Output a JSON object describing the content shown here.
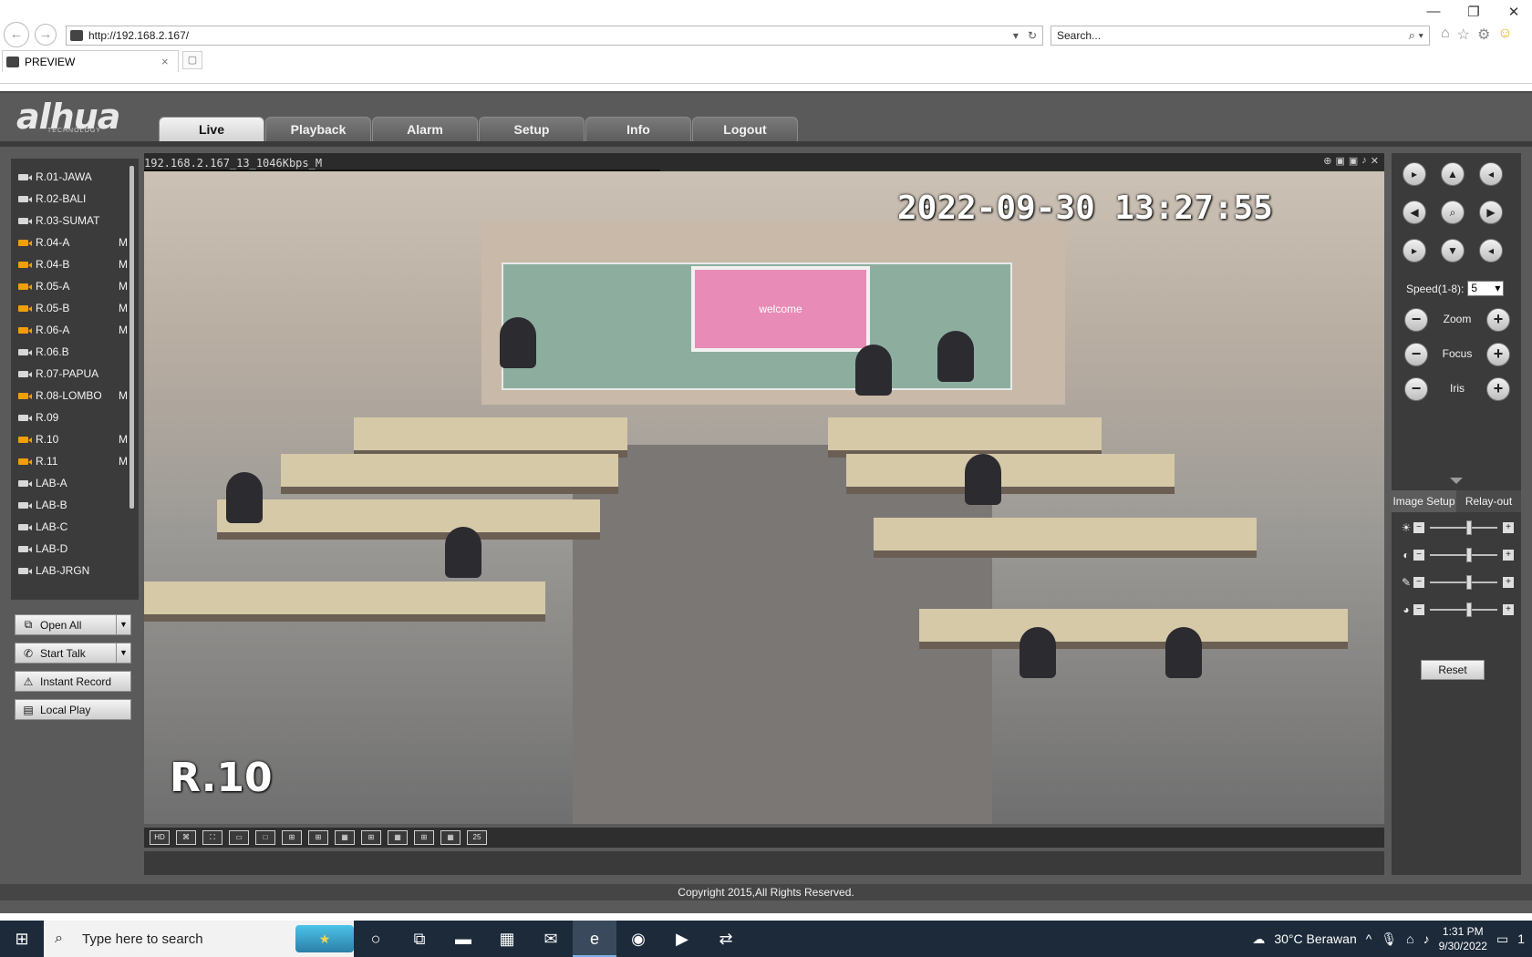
{
  "browser": {
    "url": "http://192.168.2.167/",
    "search_placeholder": "Search...",
    "tab_title": "PREVIEW",
    "tab_close": "×"
  },
  "app": {
    "logo": "alhua",
    "logo_sub": "TECHNOLOGY",
    "nav": [
      "Live",
      "Playback",
      "Alarm",
      "Setup",
      "Info",
      "Logout"
    ],
    "active_nav": "Live",
    "channels": [
      {
        "label": "R.01-JAWA",
        "active": false,
        "flag": ""
      },
      {
        "label": "R.02-BALI",
        "active": false,
        "flag": ""
      },
      {
        "label": "R.03-SUMAT",
        "active": false,
        "flag": ""
      },
      {
        "label": "R.04-A",
        "active": true,
        "flag": "M"
      },
      {
        "label": "R.04-B",
        "active": true,
        "flag": "M"
      },
      {
        "label": "R.05-A",
        "active": true,
        "flag": "M"
      },
      {
        "label": "R.05-B",
        "active": true,
        "flag": "M"
      },
      {
        "label": "R.06-A",
        "active": true,
        "flag": "M"
      },
      {
        "label": "R.06.B",
        "active": false,
        "flag": ""
      },
      {
        "label": "R.07-PAPUA",
        "active": false,
        "flag": ""
      },
      {
        "label": "R.08-LOMBO",
        "active": true,
        "flag": "M"
      },
      {
        "label": "R.09",
        "active": false,
        "flag": ""
      },
      {
        "label": "R.10",
        "active": true,
        "flag": "M"
      },
      {
        "label": "R.11",
        "active": true,
        "flag": "M"
      },
      {
        "label": "LAB-A",
        "active": false,
        "flag": ""
      },
      {
        "label": "LAB-B",
        "active": false,
        "flag": ""
      },
      {
        "label": "LAB-C",
        "active": false,
        "flag": ""
      },
      {
        "label": "LAB-D",
        "active": false,
        "flag": ""
      },
      {
        "label": "LAB-JRGN",
        "active": false,
        "flag": ""
      }
    ],
    "side_buttons": {
      "open_all": "Open All",
      "start_talk": "Start Talk",
      "instant_record": "Instant Record",
      "local_play": "Local Play"
    },
    "video": {
      "stream_title": "192.168.2.167_13_1046Kbps_M",
      "timestamp": "2022-09-30 13:27:55",
      "camera_name": "R.10",
      "screen_text": "welcome"
    },
    "layout_buttons": [
      "HD",
      "⌘",
      "⛶",
      "▭",
      "□",
      "⊞",
      "⊞",
      "▦",
      "⊞",
      "▦",
      "⊞",
      "▦",
      "25"
    ],
    "ptz": {
      "speed_label": "Speed(1-8):",
      "speed_value": "5",
      "zoom_label": "Zoom",
      "focus_label": "Focus",
      "iris_label": "Iris",
      "tab_image_setup": "Image Setup",
      "tab_relay_out": "Relay-out",
      "reset_label": "Reset"
    },
    "footer": "Copyright 2015,All Rights Reserved."
  },
  "taskbar": {
    "search_placeholder": "Type here to search",
    "weather": "30°C  Berawan",
    "time": "1:31 PM",
    "date": "9/30/2022",
    "notifications": "1"
  }
}
